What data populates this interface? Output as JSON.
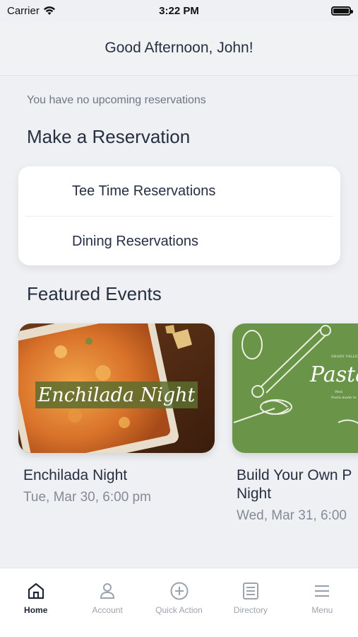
{
  "status_bar": {
    "carrier": "Carrier",
    "time": "3:22 PM"
  },
  "header": {
    "greeting": "Good Afternoon, John!"
  },
  "reservations": {
    "empty_message": "You have no upcoming reservations",
    "section_title": "Make a Reservation",
    "items": [
      {
        "label": "Tee Time Reservations"
      },
      {
        "label": "Dining Reservations"
      }
    ]
  },
  "events": {
    "section_title": "Featured Events",
    "items": [
      {
        "image_text": "Enchilada Night",
        "title": "Enchilada Night",
        "date": "Tue, Mar 30, 6:00 pm"
      },
      {
        "image_text": "Pasta",
        "title_line1": "Build Your Own P",
        "title_line2": "Night",
        "date": "Wed, Mar 31, 6:00"
      }
    ]
  },
  "tab_bar": {
    "items": [
      {
        "label": "Home",
        "icon": "home-icon",
        "active": true
      },
      {
        "label": "Account",
        "icon": "person-icon"
      },
      {
        "label": "Quick Action",
        "icon": "plus-circle-icon"
      },
      {
        "label": "Directory",
        "icon": "directory-icon"
      },
      {
        "label": "Menu",
        "icon": "hamburger-icon"
      }
    ]
  },
  "colors": {
    "background": "#eef0f3",
    "text_primary": "#263041",
    "text_secondary": "#858b96",
    "event2_green": "#6a9448"
  }
}
